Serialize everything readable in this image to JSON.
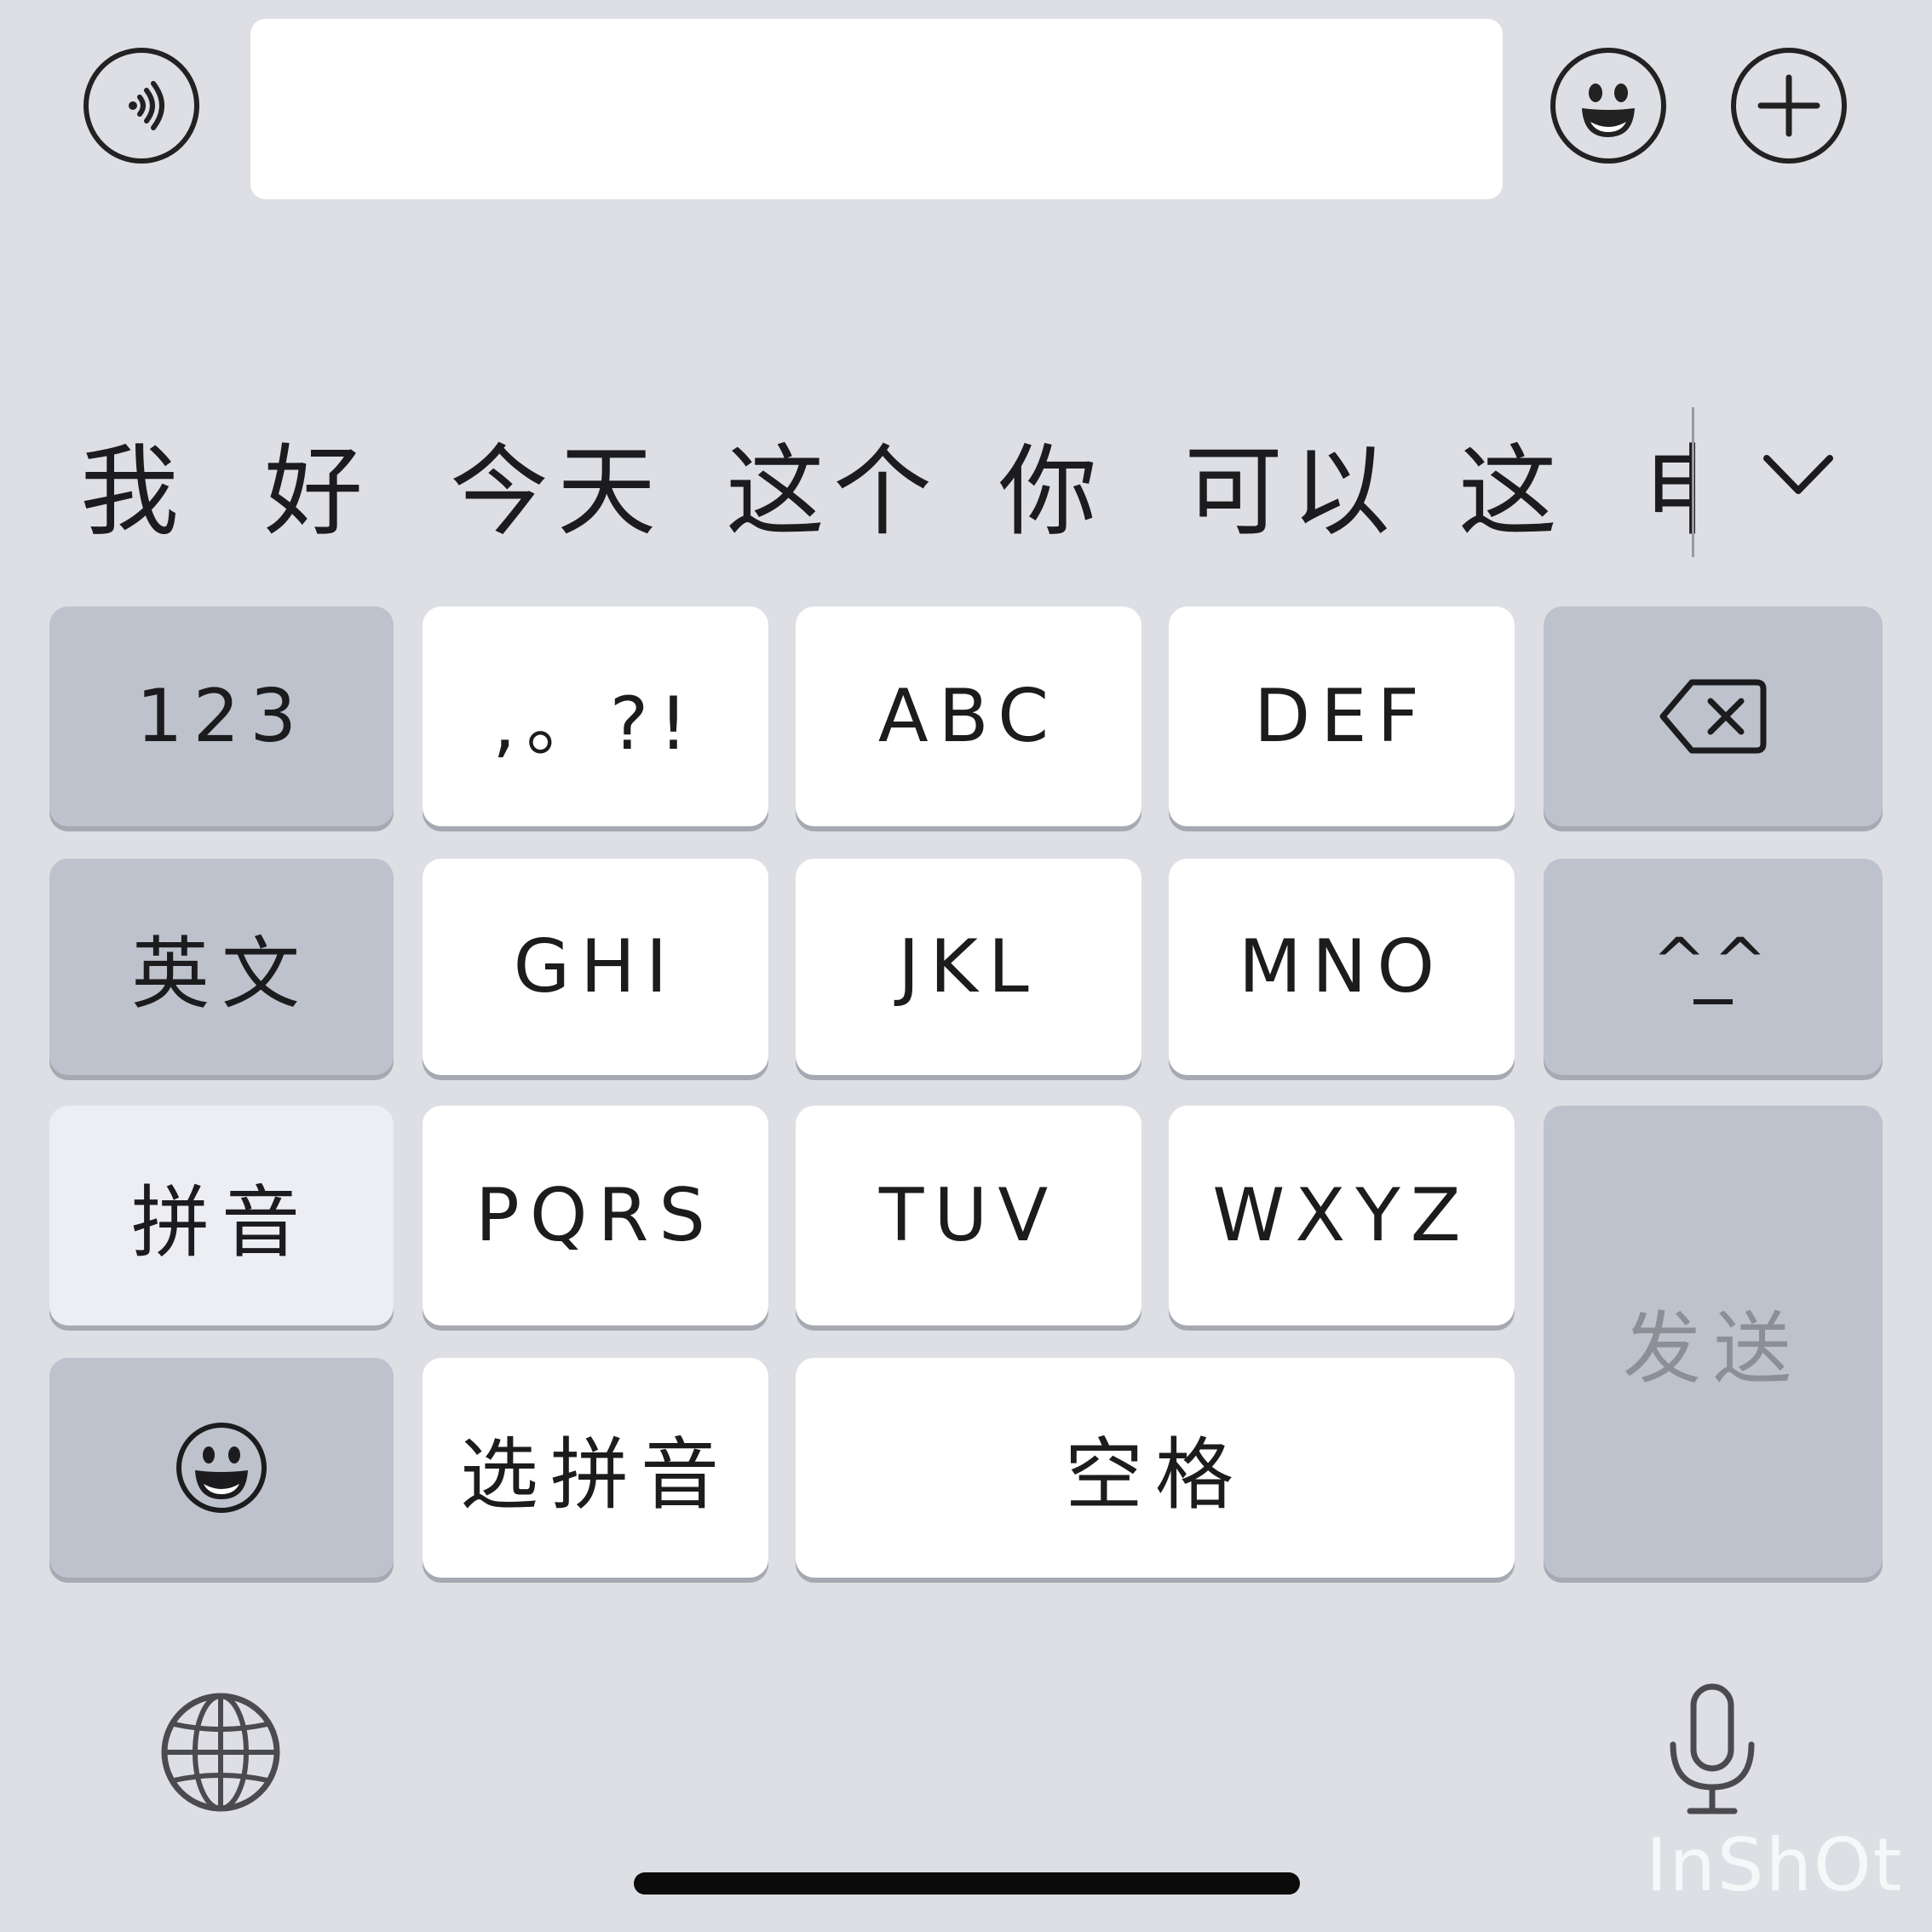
{
  "input_bar": {
    "voice_icon": "voice-icon",
    "text_value": "",
    "emoji_icon": "emoji-icon",
    "plus_icon": "plus-icon"
  },
  "candidates": {
    "items": [
      "我",
      "好",
      "今天",
      "这个",
      "你",
      "可以",
      "这",
      "申"
    ],
    "expand_icon": "chevron-down-icon"
  },
  "keyboard": {
    "row1": {
      "left": "123",
      "k1": ",。?!",
      "k2": "ABC",
      "k3": "DEF",
      "right_icon": "backspace-icon"
    },
    "row2": {
      "left": "英文",
      "k1": "GHI",
      "k2": "JKL",
      "k3": "MNO",
      "right": "^^"
    },
    "row3": {
      "left": "拼音",
      "k1": "PQRS",
      "k2": "TUV",
      "k3": "WXYZ"
    },
    "row4": {
      "left_icon": "emoji-icon",
      "k1": "选拼音",
      "space": "空格"
    },
    "send": "发送"
  },
  "bottom": {
    "globe_icon": "globe-icon",
    "mic_icon": "microphone-icon"
  },
  "watermark": "InShOt"
}
